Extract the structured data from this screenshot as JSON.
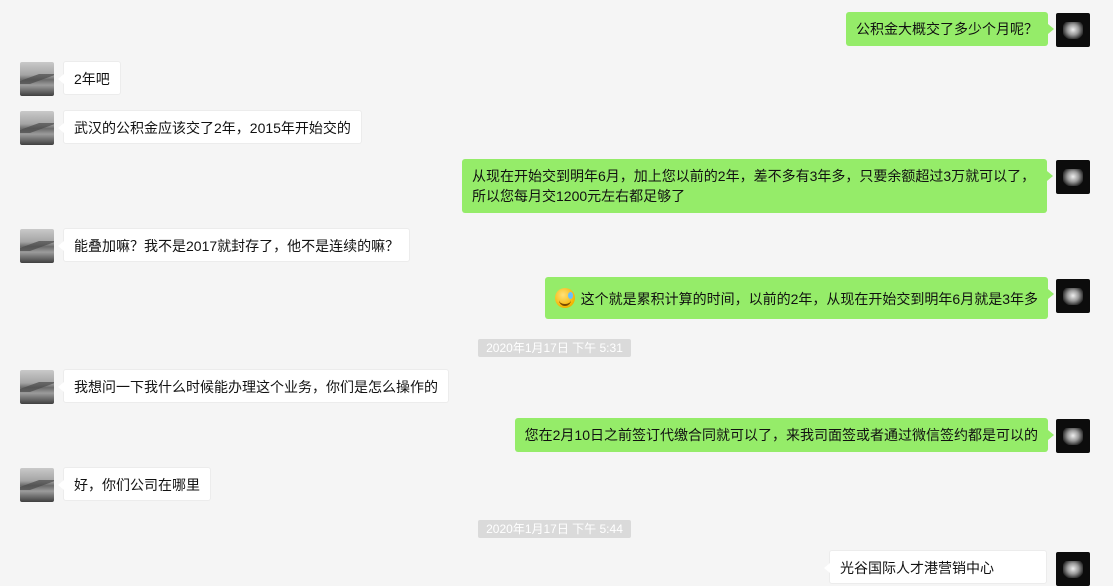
{
  "messages": [
    {
      "side": "right",
      "text": "公积金大概交了多少个月呢？"
    },
    {
      "side": "left",
      "text": "2年吧"
    },
    {
      "side": "left",
      "text": "武汉的公积金应该交了2年，2015年开始交的"
    },
    {
      "side": "right",
      "lines": [
        "从现在开始交到明年6月，加上您以前的2年，差不多有3年多，只要余额超过3万就可以了，",
        "所以您每月交1200元左右都足够了"
      ]
    },
    {
      "side": "left",
      "text": "能叠加嘛？我不是2017就封存了，他不是连续的嘛？"
    },
    {
      "side": "right",
      "emoji": "laugh-cry-emoji",
      "text": "这个就是累积计算的时间，以前的2年，从现在开始交到明年6月就是3年多"
    },
    {
      "type": "timestamp",
      "text": "2020年1月17日 下午 5:31"
    },
    {
      "side": "left",
      "text": "我想问一下我什么时候能办理这个业务，你们是怎么操作的"
    },
    {
      "side": "right",
      "text": "您在2月10日之前签订代缴合同就可以了，来我司面签或者通过微信签约都是可以的"
    },
    {
      "side": "left",
      "text": "好，你们公司在哪里"
    },
    {
      "type": "timestamp",
      "text": "2020年1月17日 下午 5:44"
    },
    {
      "side": "right-card",
      "text": "光谷国际人才港营销中心"
    }
  ],
  "colors": {
    "background": "#f5f5f5",
    "outgoing": "#95ec69",
    "incoming": "#ffffff",
    "timestamp_bg": "#dadada"
  }
}
